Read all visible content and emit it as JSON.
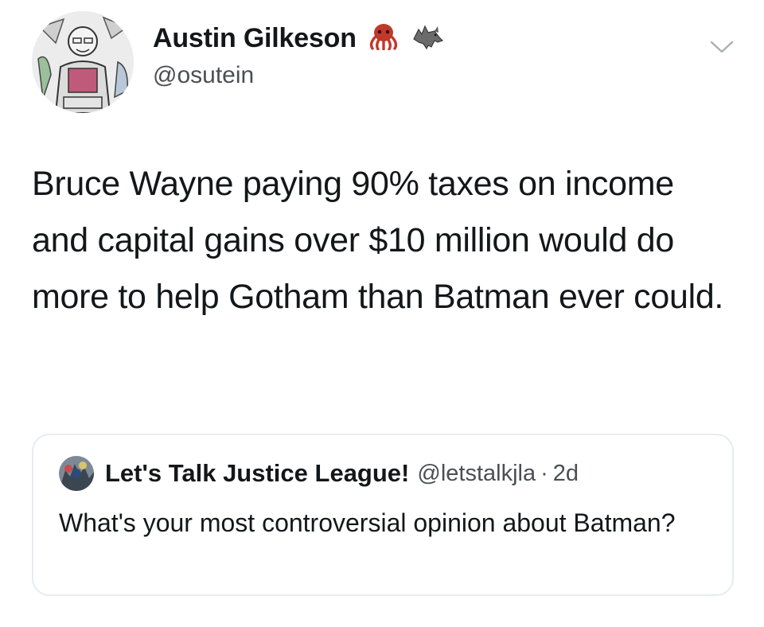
{
  "author": {
    "display_name": "Austin Gilkeson",
    "handle": "@osutein",
    "badges": [
      "octopus-emoji",
      "wolf-emoji"
    ]
  },
  "tweet": {
    "text": "Bruce Wayne paying 90% taxes on income and capital gains over $10 million would do more to help Gotham than Batman ever could."
  },
  "quoted_tweet": {
    "display_name": "Let's Talk Justice League!",
    "handle": "@letstalkjla",
    "separator": "·",
    "time": "2d",
    "text": "What's your most controversial opinion about Batman?"
  },
  "icons": {
    "menu": "chevron-down-icon"
  },
  "colors": {
    "text": "#14171a",
    "secondary": "#4a4f54",
    "border": "#e6ecf0",
    "octopus": "#c0392b"
  }
}
